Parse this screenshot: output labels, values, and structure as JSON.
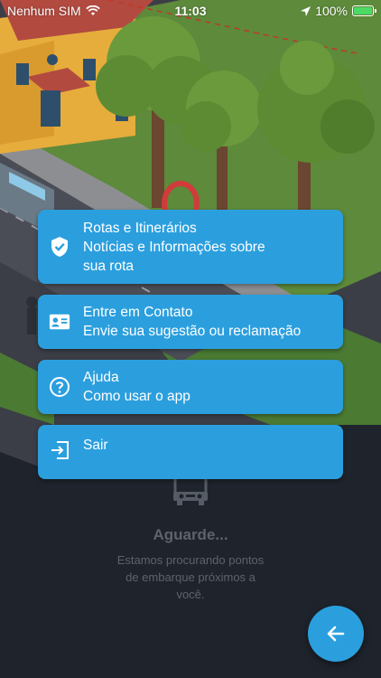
{
  "status_bar": {
    "carrier": "Nenhum SIM",
    "time": "11:03",
    "battery": "100%"
  },
  "menu": {
    "items": [
      {
        "icon": "shield-check-icon",
        "title": "Rotas e Itinerários",
        "subtitle_line1": "Notícias e Informações sobre",
        "subtitle_line2": "sua rota"
      },
      {
        "icon": "contact-card-icon",
        "title": "Entre em Contato",
        "subtitle_line1": "Envie sua sugestão ou reclamação"
      },
      {
        "icon": "help-circle-icon",
        "title": "Ajuda",
        "subtitle_line1": "Como usar o app"
      },
      {
        "icon": "logout-icon",
        "title": "Sair"
      }
    ]
  },
  "loading": {
    "icon": "bus-icon",
    "title": "Aguarde...",
    "message": "Estamos procurando pontos de embarque próximos a você."
  },
  "fab": {
    "icon": "arrow-left-icon"
  },
  "colors": {
    "accent": "#2b9fde",
    "background": "#1f232b",
    "muted_text": "#5d636d"
  }
}
